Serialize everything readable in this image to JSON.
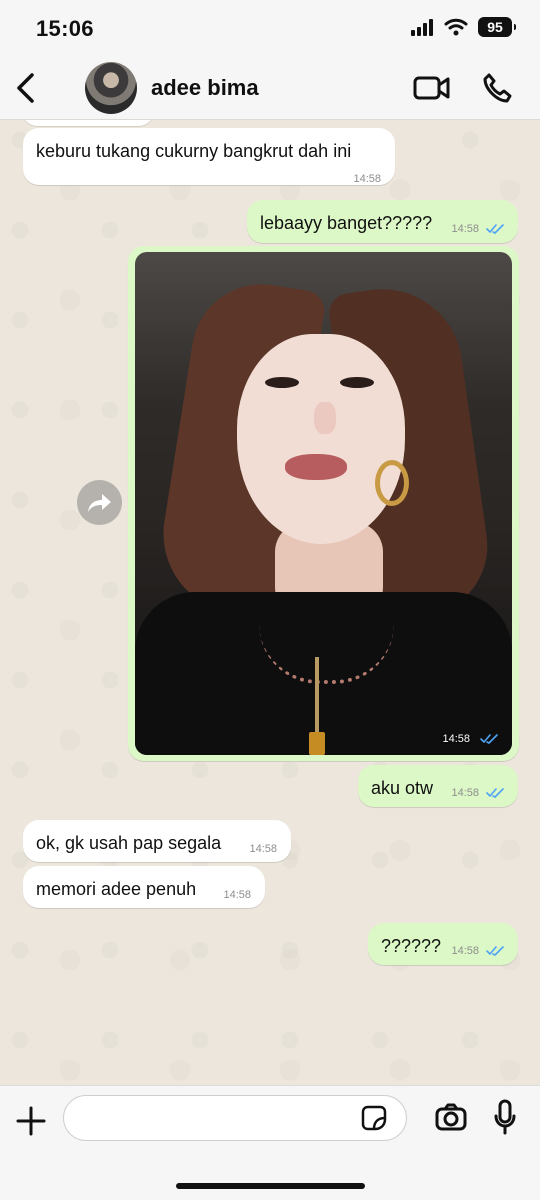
{
  "status_bar": {
    "time": "15:06",
    "battery": "95",
    "icons": [
      "signal-icon",
      "wifi-icon",
      "battery-icon"
    ]
  },
  "chat_header": {
    "contact_name": "adee bima",
    "icons": [
      "chevron-left-icon",
      "video-call-icon",
      "phone-icon"
    ]
  },
  "messages": [
    {
      "direction": "incoming",
      "text": "keburu tukang cukurny bangkrut dah ini",
      "time": "14:58"
    },
    {
      "direction": "outgoing",
      "text": "lebaayy banget?????",
      "time": "14:58",
      "read": true
    },
    {
      "direction": "outgoing",
      "type": "image",
      "time": "14:58",
      "read": true
    },
    {
      "direction": "outgoing",
      "text": "aku otw",
      "time": "14:58",
      "read": true
    },
    {
      "direction": "incoming",
      "text": "ok, gk usah pap segala",
      "time": "14:58"
    },
    {
      "direction": "incoming",
      "text": "memori adee penuh",
      "time": "14:58"
    },
    {
      "direction": "outgoing",
      "text": "??????",
      "time": "14:58",
      "read": true
    }
  ],
  "input_bar": {
    "placeholder": "",
    "icons": [
      "plus-icon",
      "sticker-icon",
      "camera-icon",
      "microphone-icon"
    ]
  },
  "colors": {
    "chat_background": "#ece6dc",
    "outgoing_bubble": "#dcf8c6",
    "incoming_bubble": "#ffffff",
    "read_ticks": "#4fa3f7"
  }
}
